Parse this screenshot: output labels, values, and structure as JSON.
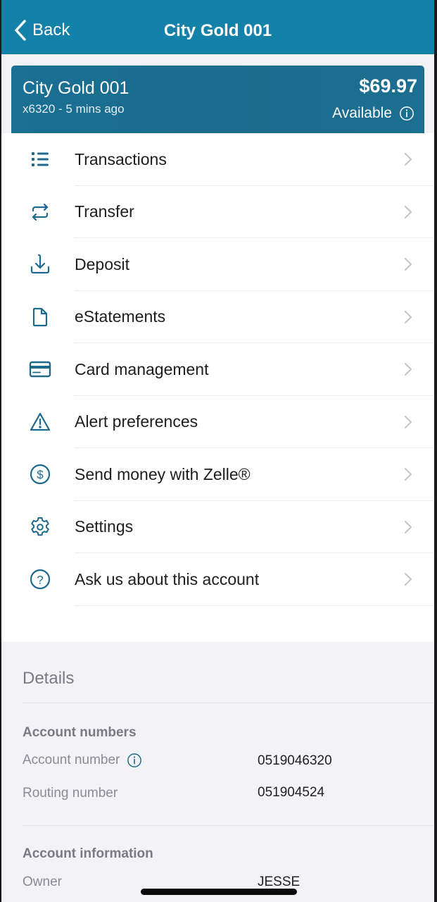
{
  "navbar": {
    "back_label": "Back",
    "title": "City Gold 001"
  },
  "account_card": {
    "name": "City Gold 001",
    "subtitle": "x6320 - 5 mins ago",
    "balance": "$69.97",
    "balance_label": "Available",
    "accent_color": "#1b6b8d"
  },
  "menu": {
    "items": [
      {
        "label": "Transactions",
        "icon": "list-icon"
      },
      {
        "label": "Transfer",
        "icon": "transfer-arrows-icon"
      },
      {
        "label": "Deposit",
        "icon": "download-icon"
      },
      {
        "label": "eStatements",
        "icon": "document-icon"
      },
      {
        "label": "Card management",
        "icon": "credit-card-icon"
      },
      {
        "label": "Alert preferences",
        "icon": "warning-icon"
      },
      {
        "label": "Send money with Zelle®",
        "icon": "dollar-circle-icon"
      },
      {
        "label": "Settings",
        "icon": "gear-icon"
      },
      {
        "label": "Ask us about this account",
        "icon": "question-circle-icon"
      }
    ]
  },
  "details": {
    "title": "Details",
    "account_numbers": {
      "heading": "Account numbers",
      "account_number_label": "Account number",
      "account_number_value": "0519046320",
      "routing_number_label": "Routing number",
      "routing_number_value": "051904524"
    },
    "account_information": {
      "heading": "Account information",
      "owner_label": "Owner",
      "owner_value": "JESSE"
    }
  },
  "colors": {
    "header": "#1482a8",
    "icon": "#1d6a8c",
    "background": "#f2f2f7"
  }
}
